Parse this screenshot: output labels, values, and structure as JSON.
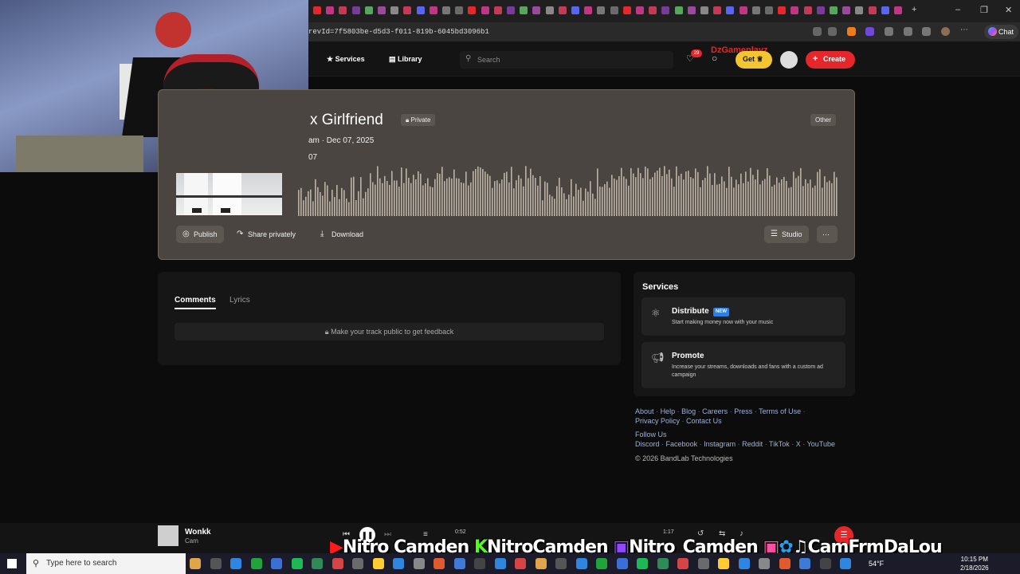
{
  "browser": {
    "url_fragment": "revId=7f5803be-d5d3-f011-819b-6045bd3096b1",
    "chat_label": "Chat"
  },
  "header": {
    "services_label": "Services",
    "library_label": "Library",
    "search_placeholder": "Search",
    "notification_count": "29",
    "get_label": "Get",
    "create_label": "Create",
    "overlay_username": "DzGameplayz"
  },
  "track": {
    "title": "x Girlfriend",
    "privacy_badge": "Private",
    "genre_badge": "Other",
    "meta": "am · Dec 07, 2025",
    "plays": "07",
    "actions": {
      "publish": "Publish",
      "share_privately": "Share privately",
      "download": "Download",
      "studio": "Studio"
    }
  },
  "comments": {
    "tab_comments": "Comments",
    "tab_lyrics": "Lyrics",
    "feedback_notice": "Make your track public to get feedback"
  },
  "services": {
    "title": "Services",
    "items": [
      {
        "title": "Distribute",
        "badge": "NEW",
        "description": "Start making money now with your music"
      },
      {
        "title": "Promote",
        "description": "Increase your streams, downloads and fans with a custom ad campaign"
      }
    ]
  },
  "footer": {
    "links": [
      "About",
      "Help",
      "Blog",
      "Careers",
      "Press",
      "Terms of Use",
      "Privacy Policy",
      "Contact Us"
    ],
    "follow_us": "Follow Us",
    "social": [
      "Discord",
      "Facebook",
      "Instagram",
      "Reddit",
      "TikTok",
      "X",
      "YouTube"
    ],
    "copyright": "© 2026 BandLab Technologies"
  },
  "player": {
    "track_name": "Wonkk",
    "artist": "Cam",
    "elapsed": "0:52",
    "duration": "1:17"
  },
  "stream_overlay": {
    "youtube": "Nitro Camden",
    "kick": "NitroCamden",
    "twitch": "Nitro_Camden",
    "socials": "CamFrmDaLou"
  },
  "taskbar": {
    "search_placeholder": "Type here to search",
    "temperature": "54°F",
    "time": "10:15 PM",
    "date": "2/18/2026"
  },
  "colors": {
    "accent_red": "#e5262b",
    "get_yellow": "#f2c531",
    "card_bg": "#4a4540",
    "link_blue": "#9fb2d6"
  }
}
